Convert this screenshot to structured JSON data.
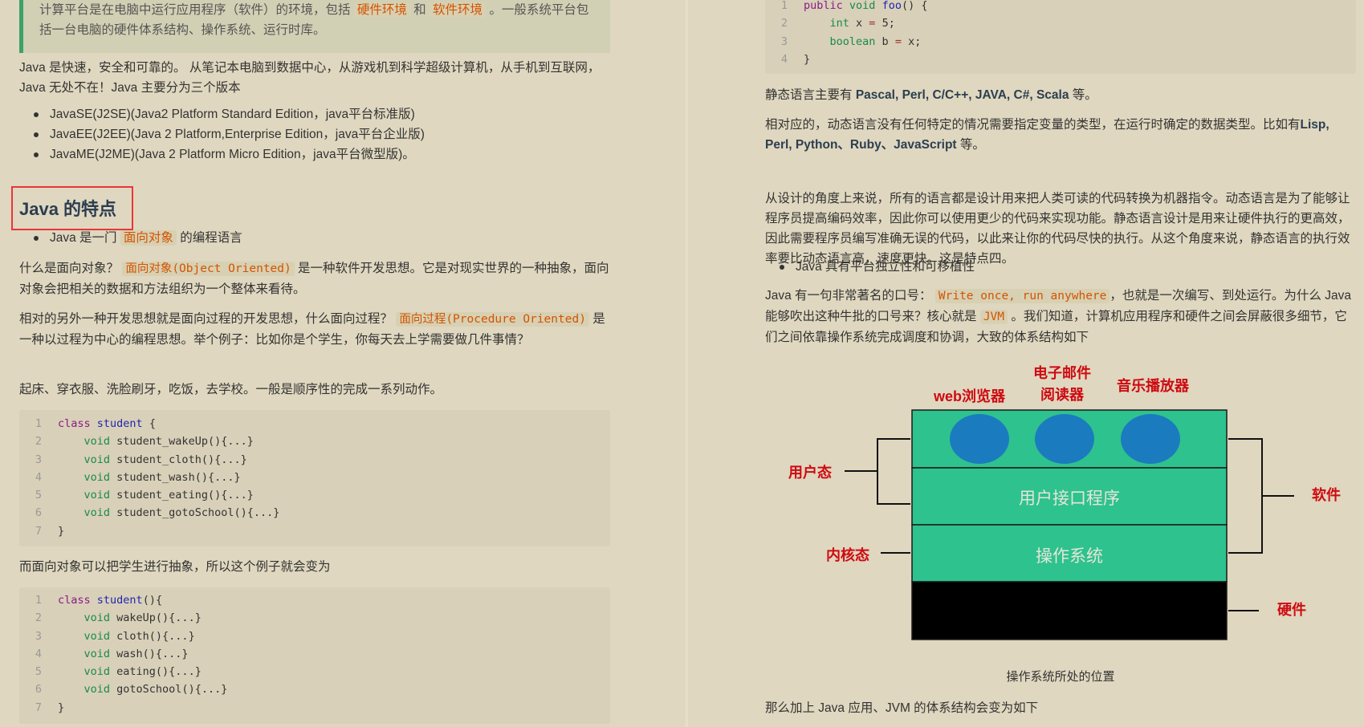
{
  "left": {
    "blockquote": {
      "part1": "计算平台是在电脑中运行应用程序（软件）的环境，包括",
      "hl1": "硬件环境",
      "part2": "和",
      "hl2": "软件环境",
      "part3": "。一般系统平台包括一台电脑的硬件体系结构、操作系统、运行时库。"
    },
    "intro": "Java 是快速，安全和可靠的。 从笔记本电脑到数据中心，从游戏机到科学超级计算机，从手机到互联网，Java 无处不在！Java 主要分为三个版本",
    "editions": [
      "JavaSE(J2SE)(Java2 Platform Standard Edition，java平台标准版)",
      "JavaEE(J2EE)(Java 2 Platform,Enterprise Edition，java平台企业版)",
      "JavaME(J2ME)(Java 2 Platform Micro Edition，java平台微型版)。"
    ],
    "heading": "Java 的特点",
    "feature1": {
      "pre": "Java 是一门",
      "hl": "面向对象",
      "post": "的编程语言"
    },
    "oo_para": {
      "pre": "什么是面向对象？",
      "code": "面向对象(Object Oriented)",
      "post": "是一种软件开发思想。它是对现实世界的一种抽象，面向对象会把相关的数据和方法组织为一个整体来看待。"
    },
    "po_para": {
      "pre": "相对的另外一种开发思想就是面向过程的开发思想，什么面向过程？",
      "code": "面向过程(Procedure Oriented)",
      "post": "是一种以过程为中心的编程思想。举个例子：比如你是个学生，你每天去上学需要做几件事情？"
    },
    "steps": "起床、穿衣服、洗脸刷牙，吃饭，去学校。一般是顺序性的完成一系列动作。",
    "code1": [
      {
        "n": "1",
        "kw": "class",
        "name": "student",
        "rest": " {"
      },
      {
        "n": "2",
        "kw": "void",
        "rest": " student_wakeUp(){...}"
      },
      {
        "n": "3",
        "kw": "void",
        "rest": " student_cloth(){...}"
      },
      {
        "n": "4",
        "kw": "void",
        "rest": " student_wash(){...}"
      },
      {
        "n": "5",
        "kw": "void",
        "rest": " student_eating(){...}"
      },
      {
        "n": "6",
        "kw": "void",
        "rest": " student_gotoSchool(){...}"
      },
      {
        "n": "7",
        "rest": "}"
      }
    ],
    "abstract_para": "而面向对象可以把学生进行抽象，所以这个例子就会变为",
    "code2": [
      {
        "n": "1",
        "kw": "class",
        "name": "student",
        "rest": "(){"
      },
      {
        "n": "2",
        "kw": "void",
        "rest": " wakeUp(){...}"
      },
      {
        "n": "3",
        "kw": "void",
        "rest": " cloth(){...}"
      },
      {
        "n": "4",
        "kw": "void",
        "rest": " wash(){...}"
      },
      {
        "n": "5",
        "kw": "void",
        "rest": " eating(){...}"
      },
      {
        "n": "6",
        "kw": "void",
        "rest": " gotoSchool(){...}"
      },
      {
        "n": "7",
        "rest": "}"
      }
    ]
  },
  "right": {
    "code": [
      {
        "n": "1",
        "t1": "public",
        "t2": "void",
        "t3": "foo",
        "rest": "() {"
      },
      {
        "n": "2",
        "type": "int",
        "a": " x ",
        "op": "=",
        "b": " 5;"
      },
      {
        "n": "3",
        "type": "boolean",
        "a": " b ",
        "op": "=",
        "b": " x;"
      },
      {
        "n": "4",
        "rest": "}"
      }
    ],
    "static_langs": {
      "pre": "静态语言主要有",
      "bold": "Pascal, Perl, C/C++, JAVA, C#, Scala",
      "post": "等。"
    },
    "dynamic_langs": {
      "pre": "相对应的，动态语言没有任何特定的情况需要指定变量的类型，在运行时确定的数据类型。比如有",
      "bold": "Lisp, Perl, Python、Ruby、JavaScript",
      "post": "等。"
    },
    "design_para": "从设计的角度上来说，所有的语言都是设计用来把人类可读的代码转换为机器指令。动态语言是为了能够让程序员提高编码效率，因此你可以使用更少的代码来实现功能。静态语言设计是用来让硬件执行的更高效，因此需要程序员编写准确无误的代码，以此来让你的代码尽快的执行。从这个角度来说，静态语言的执行效率要比动态语言高，速度更快。这是特点四。",
    "feature": "Java 具有平台独立性和可移植性",
    "slogan_para": {
      "pre": "Java 有一句非常著名的口号：",
      "code": "Write once, run anywhere",
      "mid": "，也就是一次编写、到处运行。为什么 Java 能够吹出这种牛批的口号来？核心就是",
      "code2": "JVM",
      "post": "。我们知道，计算机应用程序和硬件之间会屏蔽很多细节，它们之间依靠操作系统完成调度和协调，大致的体系结构如下"
    },
    "diagram": {
      "apps": [
        "web浏览器",
        "电子邮件\n阅读器",
        "音乐播放器"
      ],
      "layer_ui": "用户接口程序",
      "layer_os": "操作系统",
      "user_mode": "用户态",
      "kernel_mode": "内核态",
      "software": "软件",
      "hardware": "硬件",
      "colors": {
        "layer": "#2ec28e",
        "circle": "#1b7bbf",
        "hardware": "#000000",
        "label": "#cf0a12"
      }
    },
    "caption": "操作系统所处的位置",
    "last_para": "那么加上 Java 应用、JVM 的体系结构会变为如下"
  }
}
